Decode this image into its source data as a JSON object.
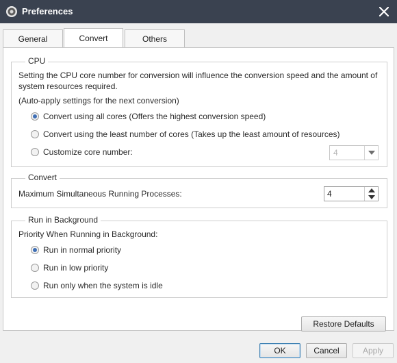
{
  "window": {
    "title": "Preferences"
  },
  "tabs": [
    {
      "label": "General",
      "active": false
    },
    {
      "label": "Convert",
      "active": true
    },
    {
      "label": "Others",
      "active": false
    }
  ],
  "cpu": {
    "title": "CPU",
    "description_line1": "Setting the CPU core number for conversion will influence the conversion speed and the amount of",
    "description_line2": "system resources required.",
    "auto_apply": "(Auto-apply settings for the next conversion)",
    "options": [
      {
        "label": "Convert using all cores (Offers the highest conversion speed)",
        "checked": true
      },
      {
        "label": "Convert using the least number of cores (Takes up the least amount of resources)",
        "checked": false
      },
      {
        "label": "Customize core number:",
        "checked": false
      }
    ],
    "core_number": {
      "value": "4",
      "disabled": true
    }
  },
  "convert": {
    "title": "Convert",
    "max_processes_label": "Maximum Simultaneous Running Processes:",
    "max_processes_value": "4"
  },
  "background": {
    "title": "Run in Background",
    "priority_label": "Priority When Running in Background:",
    "options": [
      {
        "label": "Run in normal priority",
        "checked": true
      },
      {
        "label": "Run in low priority",
        "checked": false
      },
      {
        "label": "Run only when the system is idle",
        "checked": false
      }
    ]
  },
  "buttons": {
    "restore_defaults": "Restore Defaults",
    "ok": "OK",
    "cancel": "Cancel",
    "apply": "Apply"
  },
  "colors": {
    "titlebar": "#3a4250",
    "radio_checked": "#3f6fb5",
    "default_button_border": "#3c7fb1"
  }
}
